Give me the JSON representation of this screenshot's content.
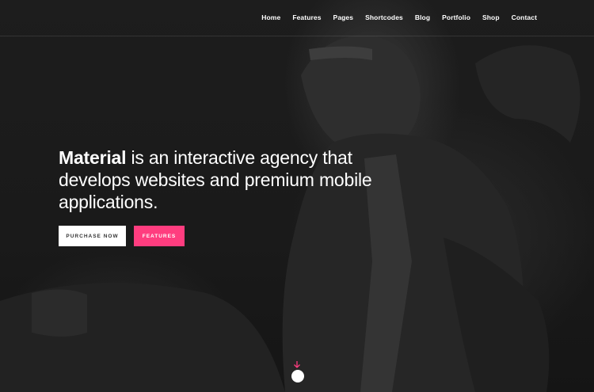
{
  "nav": {
    "items": [
      {
        "label": "Home"
      },
      {
        "label": "Features"
      },
      {
        "label": "Pages"
      },
      {
        "label": "Shortcodes"
      },
      {
        "label": "Blog"
      },
      {
        "label": "Portfolio"
      },
      {
        "label": "Shop"
      },
      {
        "label": "Contact"
      }
    ]
  },
  "hero": {
    "headline_strong": "Material",
    "headline_rest": " is an interactive agency that develops websites and premium mobile applications.",
    "primary_button": "PURCHASE NOW",
    "secondary_button": "FEATURES",
    "scroll_icon": "arrow-down-icon"
  },
  "colors": {
    "accent": "#ff3d7f",
    "background": "#1c1c1c",
    "text": "#ffffff"
  }
}
